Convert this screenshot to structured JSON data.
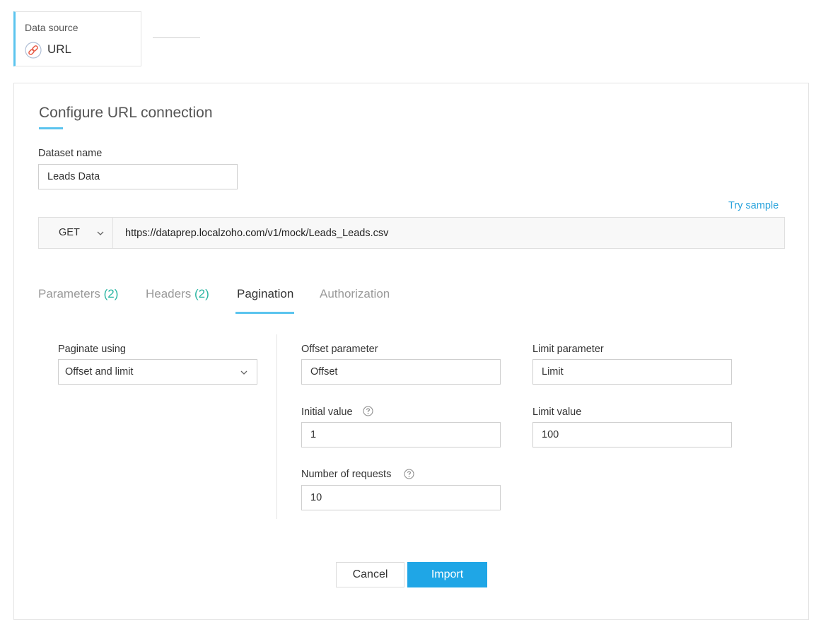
{
  "data_source": {
    "label": "Data source",
    "value": "URL",
    "icon": "link-icon"
  },
  "panel": {
    "title": "Configure URL connection"
  },
  "dataset": {
    "label": "Dataset name",
    "value": "Leads Data"
  },
  "try_sample": "Try sample",
  "request": {
    "method": "GET",
    "url": "https://dataprep.localzoho.com/v1/mock/Leads_Leads.csv"
  },
  "tabs": [
    {
      "label": "Parameters",
      "count": "(2)"
    },
    {
      "label": "Headers",
      "count": "(2)"
    },
    {
      "label": "Pagination",
      "count": ""
    },
    {
      "label": "Authorization",
      "count": ""
    }
  ],
  "active_tab": "Pagination",
  "pagination": {
    "paginate_using_label": "Paginate using",
    "paginate_using_value": "Offset and limit",
    "offset_parameter_label": "Offset parameter",
    "offset_parameter_value": "Offset",
    "limit_parameter_label": "Limit parameter",
    "limit_parameter_value": "Limit",
    "initial_value_label": "Initial value",
    "initial_value_value": "1",
    "limit_value_label": "Limit value",
    "limit_value_value": "100",
    "number_of_requests_label": "Number of requests",
    "number_of_requests_value": "10"
  },
  "actions": {
    "cancel_label": "Cancel",
    "import_label": "Import"
  },
  "colors": {
    "accent": "#5bc4ee",
    "link": "#2aa3dc",
    "count": "#2bb6a3",
    "primary_button": "#1fa6e6"
  }
}
